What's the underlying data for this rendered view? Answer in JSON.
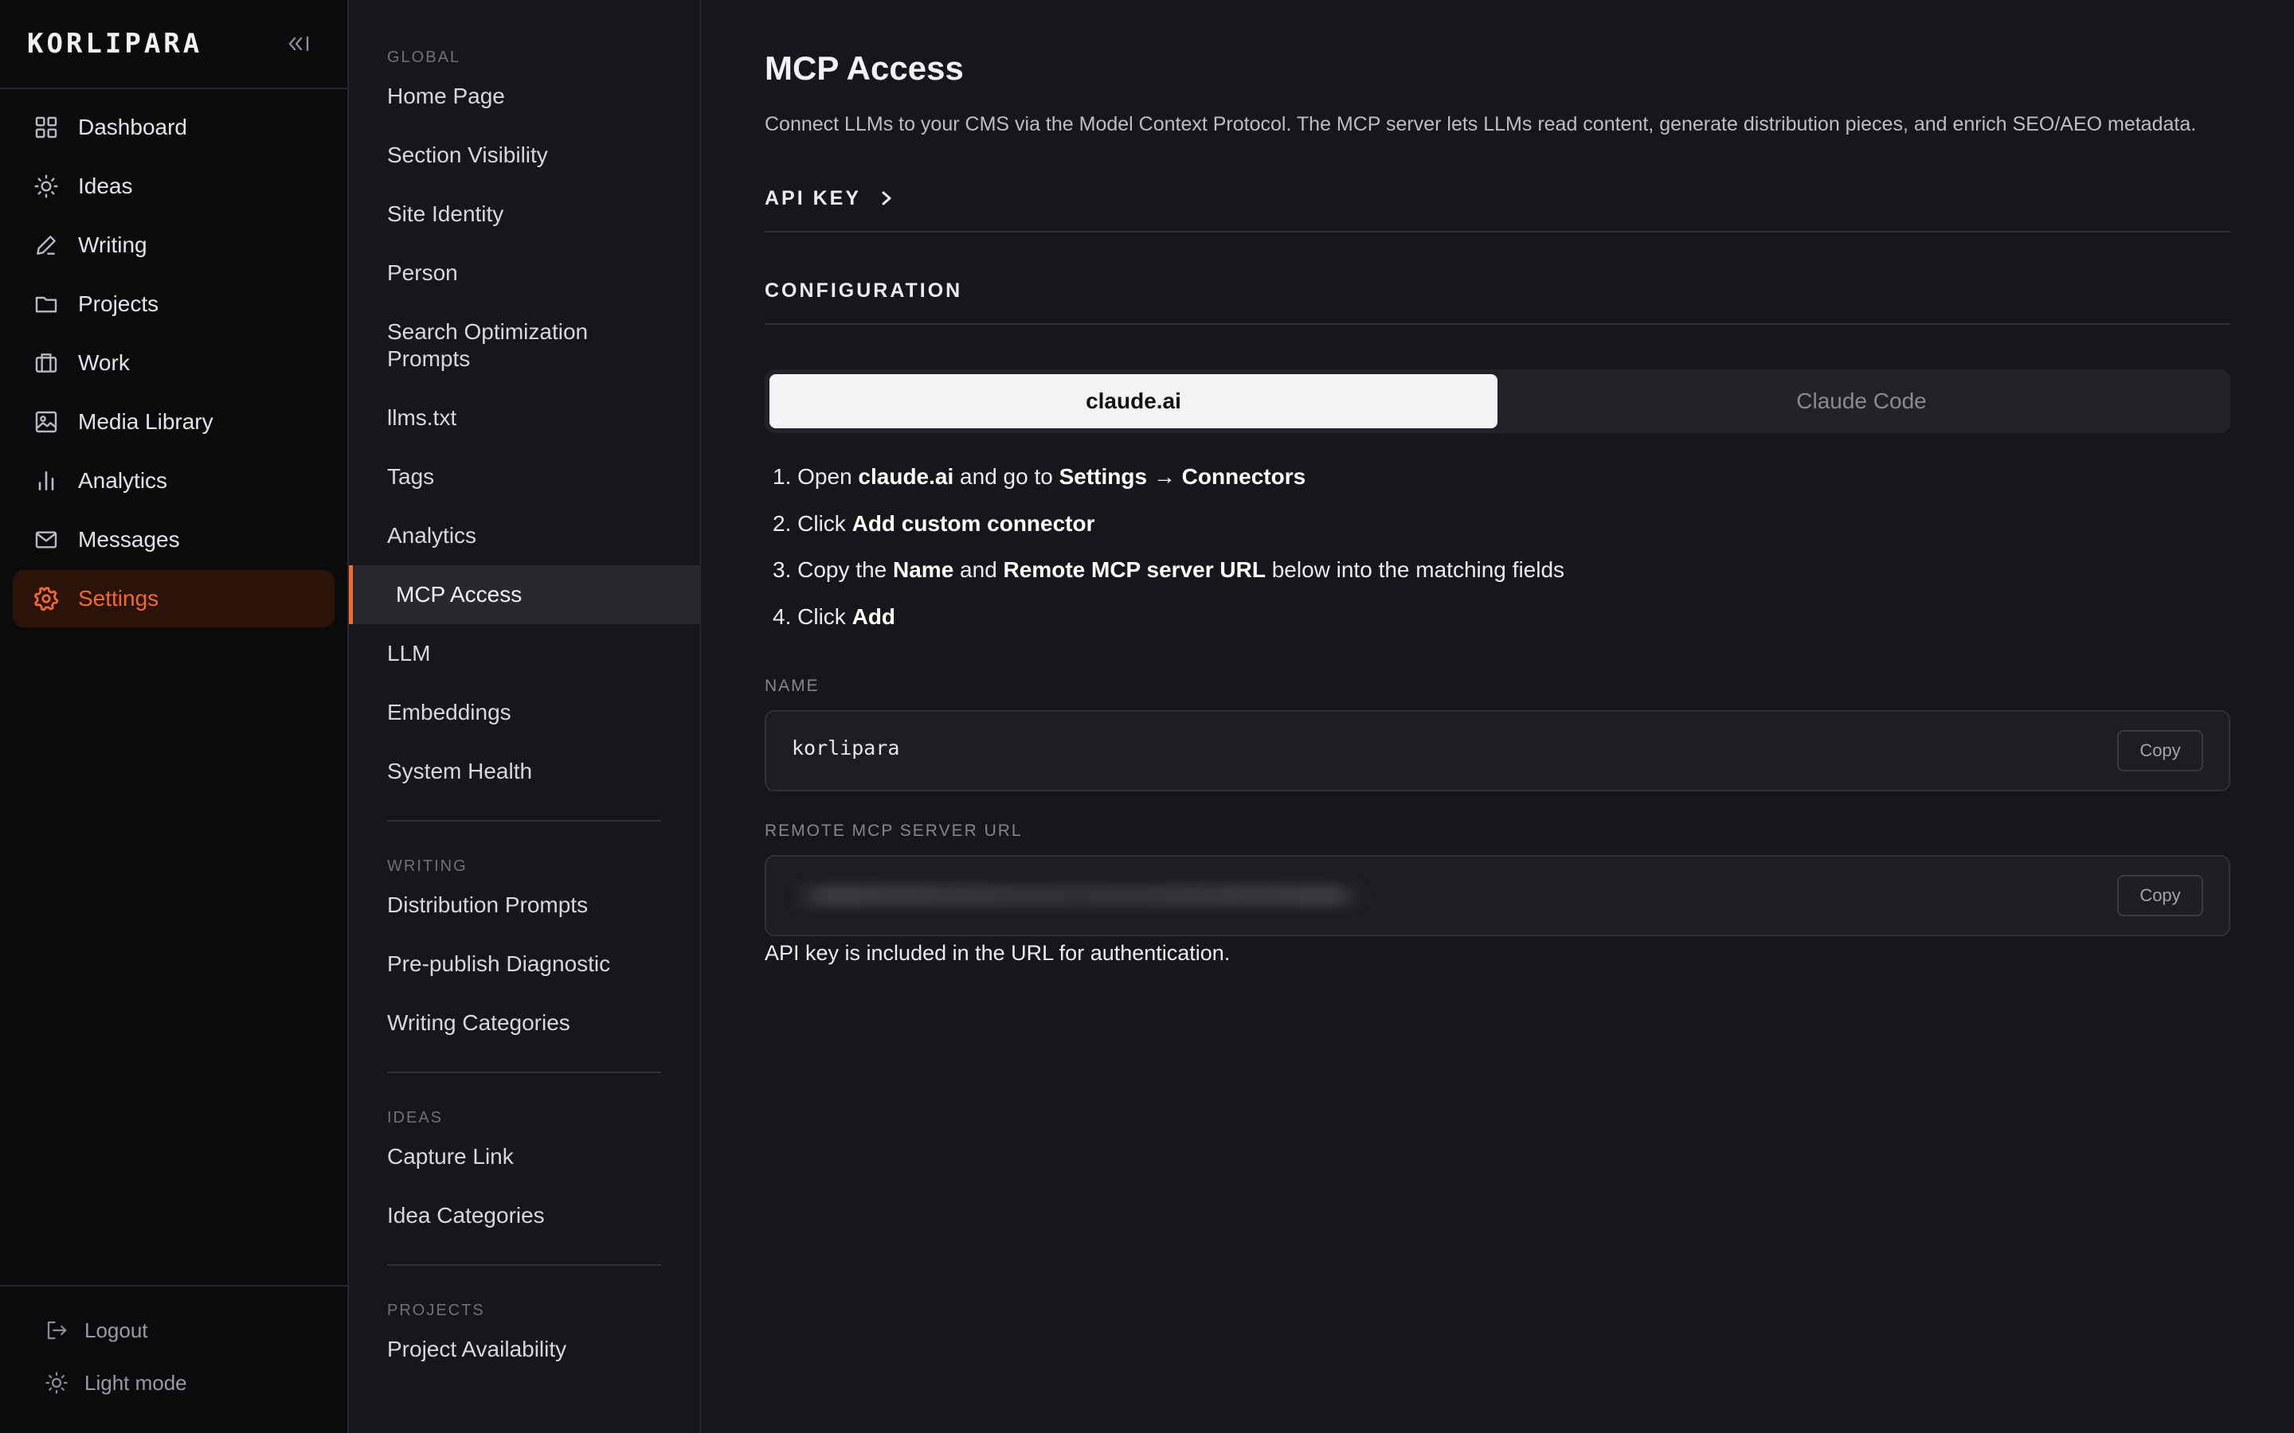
{
  "brand": "KORLIPARA",
  "sidebar": {
    "items": [
      {
        "label": "Dashboard",
        "icon": "grid-icon"
      },
      {
        "label": "Ideas",
        "icon": "lightbulb-icon"
      },
      {
        "label": "Writing",
        "icon": "pen-icon"
      },
      {
        "label": "Projects",
        "icon": "folder-icon"
      },
      {
        "label": "Work",
        "icon": "briefcase-icon"
      },
      {
        "label": "Media Library",
        "icon": "image-icon"
      },
      {
        "label": "Analytics",
        "icon": "bar-chart-icon"
      },
      {
        "label": "Messages",
        "icon": "mail-icon"
      },
      {
        "label": "Settings",
        "icon": "gear-icon",
        "active": true
      }
    ],
    "logout": "Logout",
    "light_mode": "Light mode"
  },
  "subnav": {
    "global_title": "GLOBAL",
    "global": [
      "Home Page",
      "Section Visibility",
      "Site Identity",
      "Person",
      "Search Optimization Prompts",
      "llms.txt",
      "Tags",
      "Analytics",
      "MCP Access",
      "LLM",
      "Embeddings",
      "System Health"
    ],
    "writing_title": "WRITING",
    "writing": [
      "Distribution Prompts",
      "Pre-publish Diagnostic",
      "Writing Categories"
    ],
    "ideas_title": "IDEAS",
    "ideas": [
      "Capture Link",
      "Idea Categories"
    ],
    "projects_title": "PROJECTS",
    "projects": [
      "Project Availability"
    ],
    "active": "MCP Access"
  },
  "main": {
    "title": "MCP Access",
    "description": "Connect LLMs to your CMS via the Model Context Protocol. The MCP server lets LLMs read content, generate distribution pieces, and enrich SEO/AEO metadata.",
    "api_key_heading": "API KEY",
    "config_heading": "CONFIGURATION",
    "tabs": [
      {
        "label": "claude.ai",
        "selected": true
      },
      {
        "label": "Claude Code",
        "selected": false
      }
    ],
    "steps": {
      "s1": {
        "num": "1.",
        "a": "Open ",
        "b1": "claude.ai",
        "c": " and go to ",
        "b2": "Settings → Connectors"
      },
      "s2": {
        "num": "2.",
        "a": "Click ",
        "b1": "Add custom connector"
      },
      "s3": {
        "num": "3.",
        "a": "Copy the ",
        "b1": "Name",
        "c": " and ",
        "b2": "Remote MCP server URL",
        "d": " below into the matching fields"
      },
      "s4": {
        "num": "4.",
        "a": "Click ",
        "b1": "Add"
      }
    },
    "name_label": "NAME",
    "name_value": "korlipara",
    "url_label": "REMOTE MCP SERVER URL",
    "copy_label": "Copy",
    "hint": "API key is included in the URL for authentication."
  },
  "colors": {
    "accent": "#f26a2e",
    "background": "#17171b",
    "sidebar": "#0b0b0d"
  }
}
